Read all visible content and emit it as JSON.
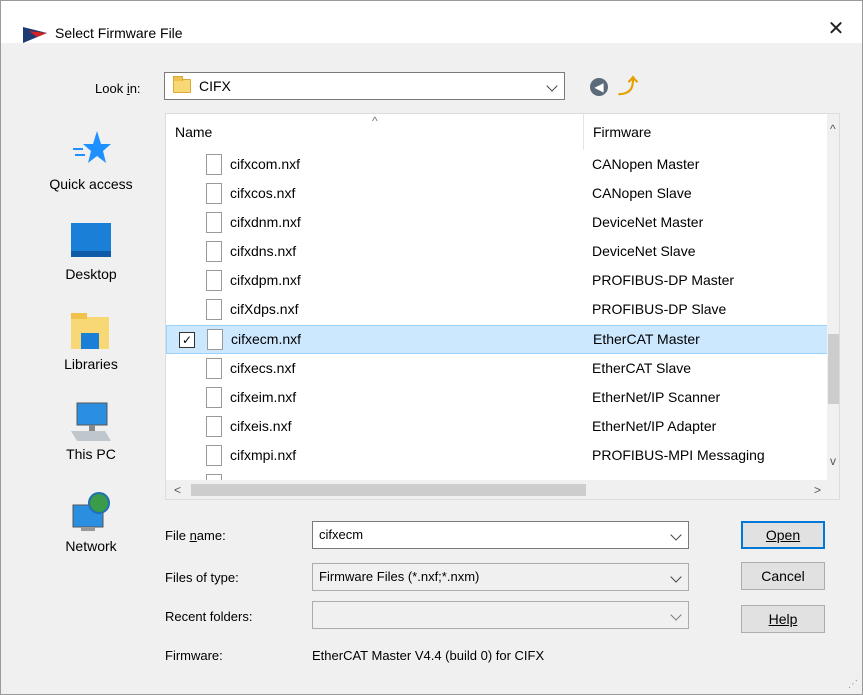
{
  "dialog": {
    "title": "Select Firmware File",
    "close_glyph": "✕"
  },
  "look_in": {
    "label": "Look in:",
    "value": "CIFX"
  },
  "nav": {
    "back_glyph": "◀",
    "up_glyph": "⤴"
  },
  "places": [
    {
      "label": "Quick access",
      "icon": "star-icon"
    },
    {
      "label": "Desktop",
      "icon": "desktop-icon"
    },
    {
      "label": "Libraries",
      "icon": "libraries-icon"
    },
    {
      "label": "This PC",
      "icon": "computer-icon"
    },
    {
      "label": "Network",
      "icon": "network-icon"
    }
  ],
  "file_list": {
    "columns": [
      "Name",
      "Firmware"
    ],
    "sort_glyph": "^",
    "rows": [
      {
        "name": "cifxcom.nxf",
        "firmware": "CANopen Master"
      },
      {
        "name": "cifxcos.nxf",
        "firmware": "CANopen Slave"
      },
      {
        "name": "cifxdnm.nxf",
        "firmware": "DeviceNet Master"
      },
      {
        "name": "cifxdns.nxf",
        "firmware": "DeviceNet Slave"
      },
      {
        "name": "cifxdpm.nxf",
        "firmware": "PROFIBUS-DP Master"
      },
      {
        "name": "cifXdps.nxf",
        "firmware": "PROFIBUS-DP Slave"
      },
      {
        "name": "cifxecm.nxf",
        "firmware": "EtherCAT Master",
        "selected": true
      },
      {
        "name": "cifxecs.nxf",
        "firmware": "EtherCAT Slave"
      },
      {
        "name": "cifxeim.nxf",
        "firmware": "EtherNet/IP Scanner"
      },
      {
        "name": "cifxeis.nxf",
        "firmware": "EtherNet/IP Adapter"
      },
      {
        "name": "cifxmpi.nxf",
        "firmware": "PROFIBUS-MPI Messaging"
      }
    ],
    "checkbox_glyph": "✓"
  },
  "scrollbar": {
    "up_glyph": "^",
    "down_glyph": "v",
    "left_glyph": "<",
    "right_glyph": ">"
  },
  "form": {
    "file_name_label": "File name:",
    "file_name_value": "cifxecm",
    "files_of_type_label": "Files of type:",
    "files_of_type_value": "Firmware Files (*.nxf;*.nxm)",
    "recent_folders_label": "Recent folders:",
    "recent_folders_value": "",
    "firmware_label": "Firmware:",
    "firmware_value": "EtherCAT Master V4.4 (build 0) for CIFX"
  },
  "buttons": {
    "open": "Open",
    "cancel": "Cancel",
    "help": "Help"
  },
  "colors": {
    "selection": "#cce8ff",
    "default_button_border": "#0078d7"
  }
}
